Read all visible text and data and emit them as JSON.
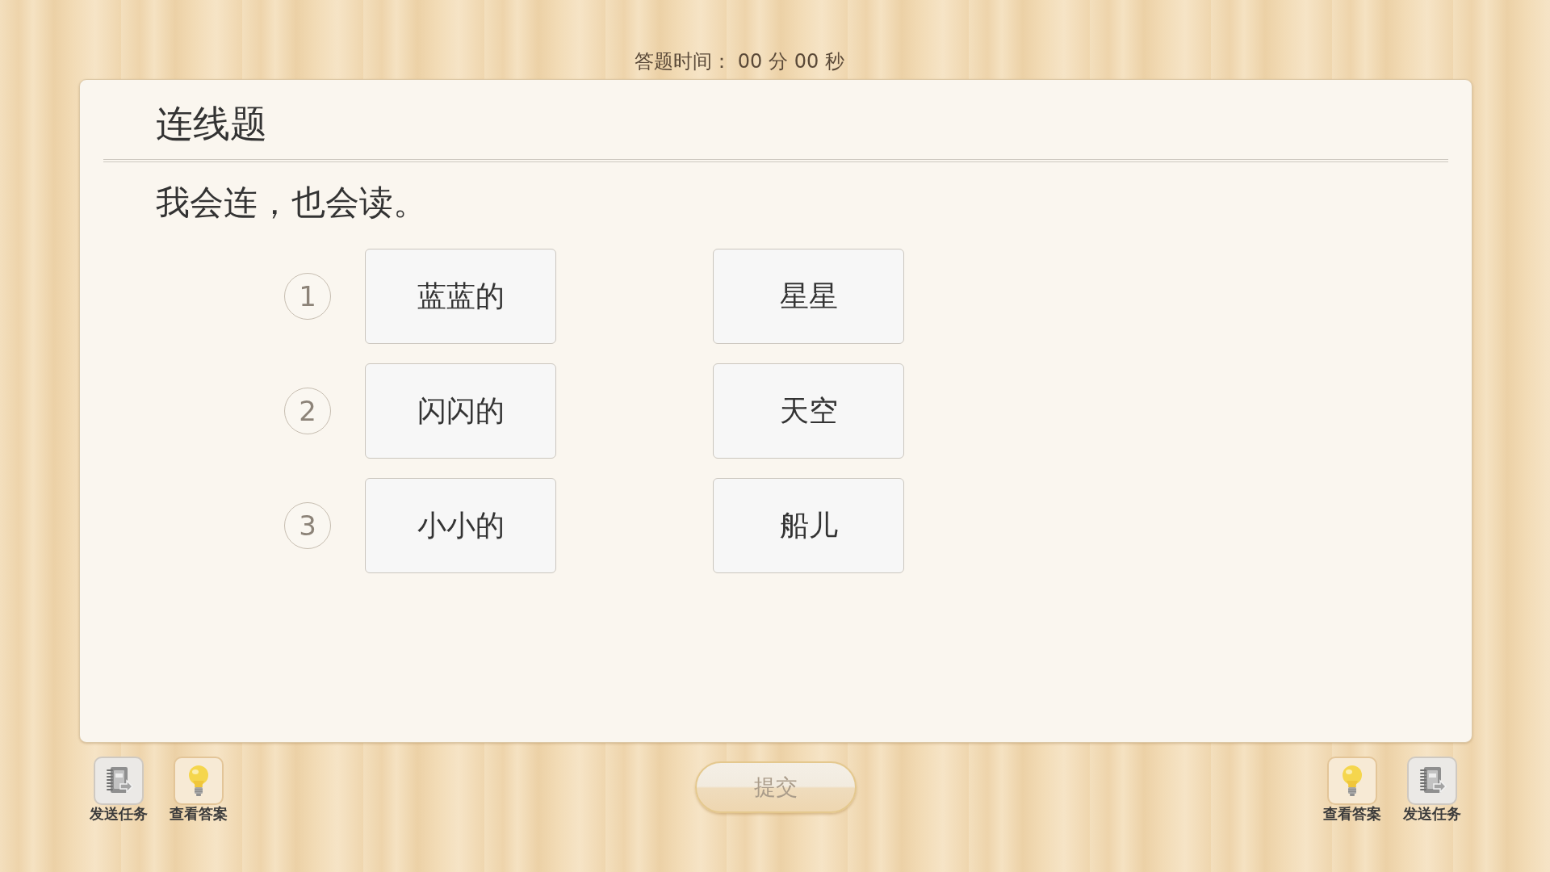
{
  "timer": "答题时间： 00 分 00 秒",
  "question": {
    "type": "连线题",
    "prompt": "我会连，也会读。"
  },
  "left_items": [
    {
      "number": "1",
      "text": "蓝蓝的"
    },
    {
      "number": "2",
      "text": "闪闪的"
    },
    {
      "number": "3",
      "text": "小小的"
    }
  ],
  "right_items": [
    "星星",
    "天空",
    "船儿"
  ],
  "toolbar_left": [
    {
      "kind": "send_task",
      "label": "发送任务"
    },
    {
      "kind": "view_answer",
      "label": "查看答案"
    }
  ],
  "submit": {
    "label": "提交",
    "disabled": true
  },
  "toolbar_right": [
    {
      "kind": "view_answer",
      "label": "查看答案"
    },
    {
      "kind": "send_task",
      "label": "发送任务"
    }
  ]
}
